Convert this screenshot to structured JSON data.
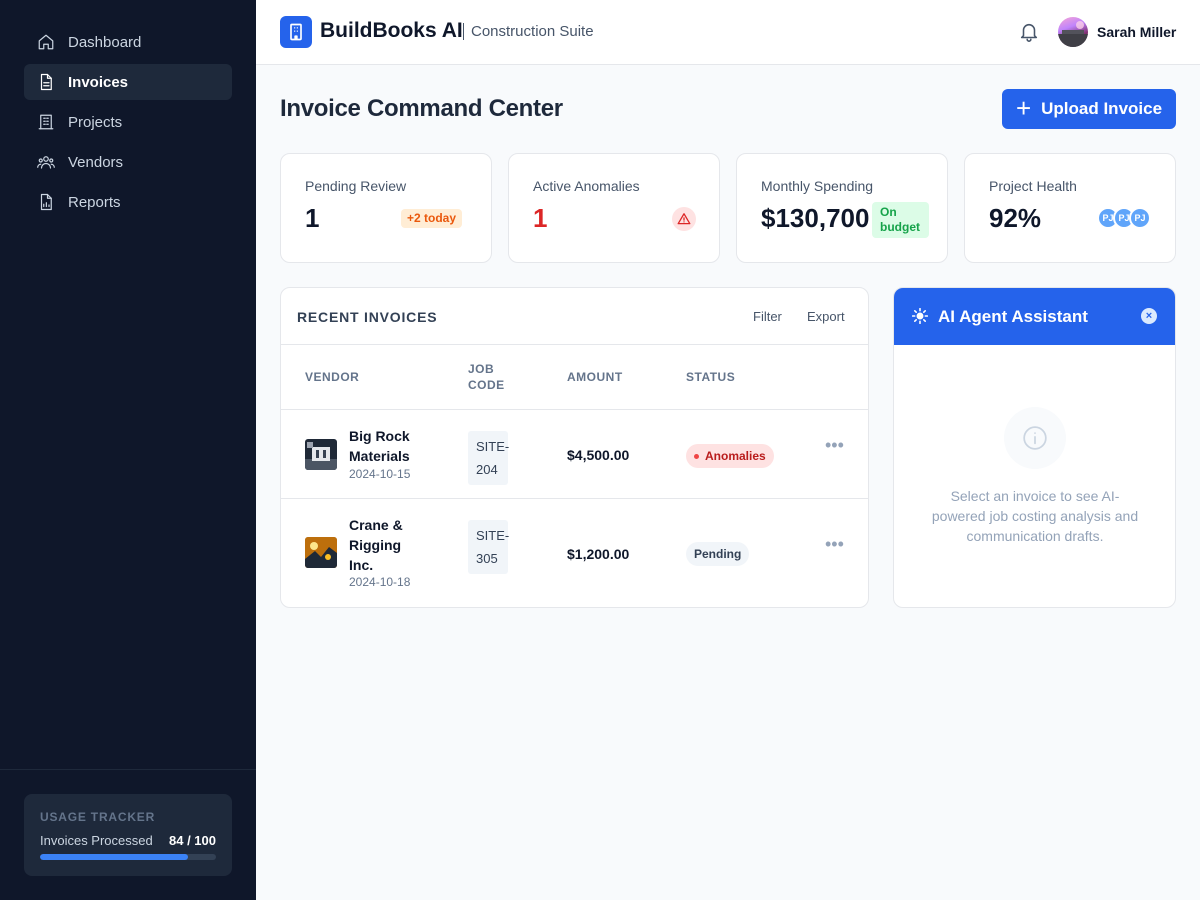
{
  "app": {
    "name": "BuildBooks AI",
    "subtitle": "Construction Suite"
  },
  "user": {
    "name": "Sarah Miller"
  },
  "sidebar": {
    "items": [
      {
        "label": "Dashboard",
        "icon": "home-icon",
        "active": false
      },
      {
        "label": "Invoices",
        "icon": "document-icon",
        "active": true
      },
      {
        "label": "Projects",
        "icon": "building-icon",
        "active": false
      },
      {
        "label": "Vendors",
        "icon": "users-icon",
        "active": false
      },
      {
        "label": "Reports",
        "icon": "chart-document-icon",
        "active": false
      }
    ],
    "usage": {
      "title": "USAGE TRACKER",
      "label": "Invoices Processed",
      "value": "84 / 100",
      "progress": 0.84
    }
  },
  "page": {
    "title": "Invoice Command Center",
    "upload_label": "Upload Invoice"
  },
  "stats": [
    {
      "label": "Pending Review",
      "value": "1",
      "badge": "+2 today"
    },
    {
      "label": "Active Anomalies",
      "value": "1",
      "icon": "warning-triangle-icon"
    },
    {
      "label": "Monthly Spending",
      "value": "$130,700",
      "badge": "On budget"
    },
    {
      "label": "Project Health",
      "value": "92%",
      "avatars": [
        "PJ",
        "PJ",
        "PJ"
      ]
    }
  ],
  "invoices": {
    "title": "RECENT INVOICES",
    "filter_label": "Filter",
    "export_label": "Export",
    "columns": [
      "VENDOR",
      "JOB CODE",
      "AMOUNT",
      "STATUS"
    ],
    "rows": [
      {
        "vendor": "Big Rock Materials",
        "date": "2024-10-15",
        "job": "SITE-204",
        "amount": "$4,500.00",
        "status": "Anomalies"
      },
      {
        "vendor": "Crane & Rigging Inc.",
        "date": "2024-10-18",
        "job": "SITE-305",
        "amount": "$1,200.00",
        "status": "Pending"
      }
    ]
  },
  "assistant": {
    "title": "AI Agent Assistant",
    "empty_text": "Select an invoice to see AI-powered job costing analysis and communication drafts."
  },
  "colors": {
    "sidebar_bg": "#0f172a",
    "accent": "#2563eb",
    "danger": "#dc2626",
    "success": "#16a34a",
    "warning": "#ea580c"
  }
}
